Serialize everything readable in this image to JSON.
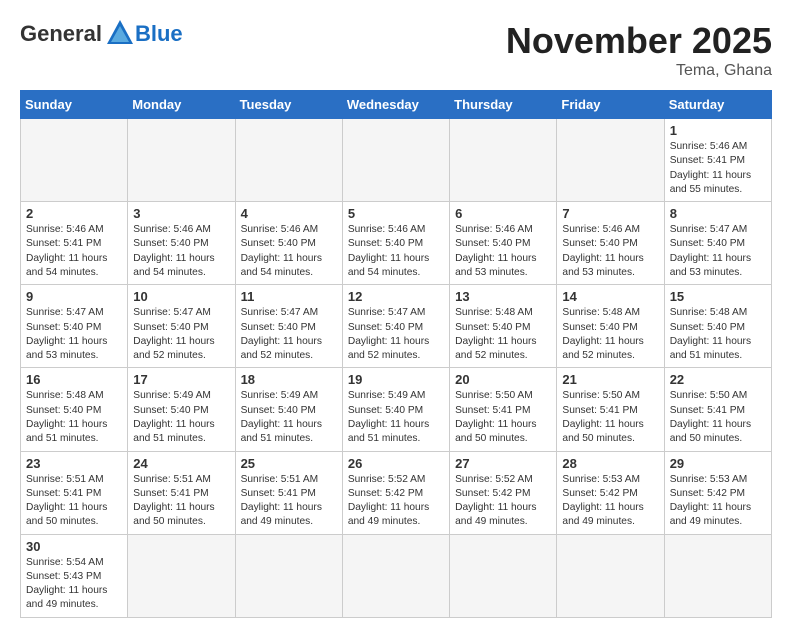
{
  "header": {
    "logo_general": "General",
    "logo_blue": "Blue",
    "month": "November 2025",
    "location": "Tema, Ghana"
  },
  "weekdays": [
    "Sunday",
    "Monday",
    "Tuesday",
    "Wednesday",
    "Thursday",
    "Friday",
    "Saturday"
  ],
  "weeks": [
    [
      {
        "day": "",
        "info": ""
      },
      {
        "day": "",
        "info": ""
      },
      {
        "day": "",
        "info": ""
      },
      {
        "day": "",
        "info": ""
      },
      {
        "day": "",
        "info": ""
      },
      {
        "day": "",
        "info": ""
      },
      {
        "day": "1",
        "info": "Sunrise: 5:46 AM\nSunset: 5:41 PM\nDaylight: 11 hours\nand 55 minutes."
      }
    ],
    [
      {
        "day": "2",
        "info": "Sunrise: 5:46 AM\nSunset: 5:41 PM\nDaylight: 11 hours\nand 54 minutes."
      },
      {
        "day": "3",
        "info": "Sunrise: 5:46 AM\nSunset: 5:40 PM\nDaylight: 11 hours\nand 54 minutes."
      },
      {
        "day": "4",
        "info": "Sunrise: 5:46 AM\nSunset: 5:40 PM\nDaylight: 11 hours\nand 54 minutes."
      },
      {
        "day": "5",
        "info": "Sunrise: 5:46 AM\nSunset: 5:40 PM\nDaylight: 11 hours\nand 54 minutes."
      },
      {
        "day": "6",
        "info": "Sunrise: 5:46 AM\nSunset: 5:40 PM\nDaylight: 11 hours\nand 53 minutes."
      },
      {
        "day": "7",
        "info": "Sunrise: 5:46 AM\nSunset: 5:40 PM\nDaylight: 11 hours\nand 53 minutes."
      },
      {
        "day": "8",
        "info": "Sunrise: 5:47 AM\nSunset: 5:40 PM\nDaylight: 11 hours\nand 53 minutes."
      }
    ],
    [
      {
        "day": "9",
        "info": "Sunrise: 5:47 AM\nSunset: 5:40 PM\nDaylight: 11 hours\nand 53 minutes."
      },
      {
        "day": "10",
        "info": "Sunrise: 5:47 AM\nSunset: 5:40 PM\nDaylight: 11 hours\nand 52 minutes."
      },
      {
        "day": "11",
        "info": "Sunrise: 5:47 AM\nSunset: 5:40 PM\nDaylight: 11 hours\nand 52 minutes."
      },
      {
        "day": "12",
        "info": "Sunrise: 5:47 AM\nSunset: 5:40 PM\nDaylight: 11 hours\nand 52 minutes."
      },
      {
        "day": "13",
        "info": "Sunrise: 5:48 AM\nSunset: 5:40 PM\nDaylight: 11 hours\nand 52 minutes."
      },
      {
        "day": "14",
        "info": "Sunrise: 5:48 AM\nSunset: 5:40 PM\nDaylight: 11 hours\nand 52 minutes."
      },
      {
        "day": "15",
        "info": "Sunrise: 5:48 AM\nSunset: 5:40 PM\nDaylight: 11 hours\nand 51 minutes."
      }
    ],
    [
      {
        "day": "16",
        "info": "Sunrise: 5:48 AM\nSunset: 5:40 PM\nDaylight: 11 hours\nand 51 minutes."
      },
      {
        "day": "17",
        "info": "Sunrise: 5:49 AM\nSunset: 5:40 PM\nDaylight: 11 hours\nand 51 minutes."
      },
      {
        "day": "18",
        "info": "Sunrise: 5:49 AM\nSunset: 5:40 PM\nDaylight: 11 hours\nand 51 minutes."
      },
      {
        "day": "19",
        "info": "Sunrise: 5:49 AM\nSunset: 5:40 PM\nDaylight: 11 hours\nand 51 minutes."
      },
      {
        "day": "20",
        "info": "Sunrise: 5:50 AM\nSunset: 5:41 PM\nDaylight: 11 hours\nand 50 minutes."
      },
      {
        "day": "21",
        "info": "Sunrise: 5:50 AM\nSunset: 5:41 PM\nDaylight: 11 hours\nand 50 minutes."
      },
      {
        "day": "22",
        "info": "Sunrise: 5:50 AM\nSunset: 5:41 PM\nDaylight: 11 hours\nand 50 minutes."
      }
    ],
    [
      {
        "day": "23",
        "info": "Sunrise: 5:51 AM\nSunset: 5:41 PM\nDaylight: 11 hours\nand 50 minutes."
      },
      {
        "day": "24",
        "info": "Sunrise: 5:51 AM\nSunset: 5:41 PM\nDaylight: 11 hours\nand 50 minutes."
      },
      {
        "day": "25",
        "info": "Sunrise: 5:51 AM\nSunset: 5:41 PM\nDaylight: 11 hours\nand 49 minutes."
      },
      {
        "day": "26",
        "info": "Sunrise: 5:52 AM\nSunset: 5:42 PM\nDaylight: 11 hours\nand 49 minutes."
      },
      {
        "day": "27",
        "info": "Sunrise: 5:52 AM\nSunset: 5:42 PM\nDaylight: 11 hours\nand 49 minutes."
      },
      {
        "day": "28",
        "info": "Sunrise: 5:53 AM\nSunset: 5:42 PM\nDaylight: 11 hours\nand 49 minutes."
      },
      {
        "day": "29",
        "info": "Sunrise: 5:53 AM\nSunset: 5:42 PM\nDaylight: 11 hours\nand 49 minutes."
      }
    ],
    [
      {
        "day": "30",
        "info": "Sunrise: 5:54 AM\nSunset: 5:43 PM\nDaylight: 11 hours\nand 49 minutes."
      },
      {
        "day": "",
        "info": ""
      },
      {
        "day": "",
        "info": ""
      },
      {
        "day": "",
        "info": ""
      },
      {
        "day": "",
        "info": ""
      },
      {
        "day": "",
        "info": ""
      },
      {
        "day": "",
        "info": ""
      }
    ]
  ]
}
